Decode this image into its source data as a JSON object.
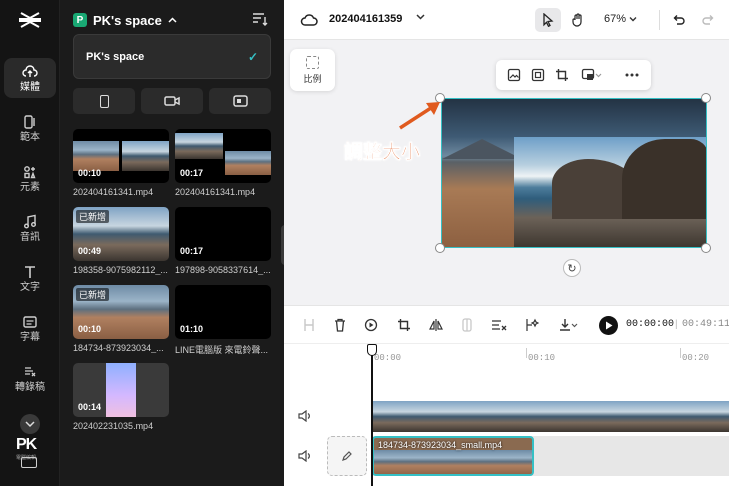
{
  "sidebar": {
    "items": [
      {
        "label": "媒體",
        "icon": "cloud-upload-icon"
      },
      {
        "label": "範本",
        "icon": "template-icon"
      },
      {
        "label": "元素",
        "icon": "elements-icon"
      },
      {
        "label": "音訊",
        "icon": "music-note-icon"
      },
      {
        "label": "文字",
        "icon": "text-icon"
      },
      {
        "label": "字幕",
        "icon": "captions-icon"
      },
      {
        "label": "轉錄稿",
        "icon": "transcript-icon"
      }
    ],
    "watermark": "PK",
    "watermark_sub": "電腦編輯"
  },
  "panel": {
    "space_badge": "P",
    "space_name": "PK's space",
    "space_option": "PK's space",
    "media": [
      {
        "name": "202404161341.mp4",
        "duration": "00:10",
        "added": ""
      },
      {
        "name": "202404161341.mp4",
        "duration": "00:17",
        "added": ""
      },
      {
        "name": "198358-9075982112_...",
        "duration": "00:49",
        "added": "已新增"
      },
      {
        "name": "197898-9058337614_...",
        "duration": "00:17",
        "added": ""
      },
      {
        "name": "184734-873923034_...",
        "duration": "00:10",
        "added": "已新增"
      },
      {
        "name": "LINE電腦版 來電鈴聲...",
        "duration": "01:10",
        "added": ""
      },
      {
        "name": "202402231035.mp4",
        "duration": "00:14",
        "added": ""
      }
    ]
  },
  "topbar": {
    "project_title": "202404161359",
    "zoom": "67%"
  },
  "canvas": {
    "ratio_label": "比例",
    "annotation": "調整大小"
  },
  "timeline": {
    "current_time": "00:00:00",
    "separator": "|",
    "total_time": "00:49:11",
    "ticks": [
      "00:00",
      "00:10",
      "00:20"
    ],
    "clip_label": "184734-873923034_small.mp4"
  },
  "colors": {
    "accent": "#35c0c5",
    "annotation": "#e05a1e",
    "space_badge": "#19a974"
  }
}
